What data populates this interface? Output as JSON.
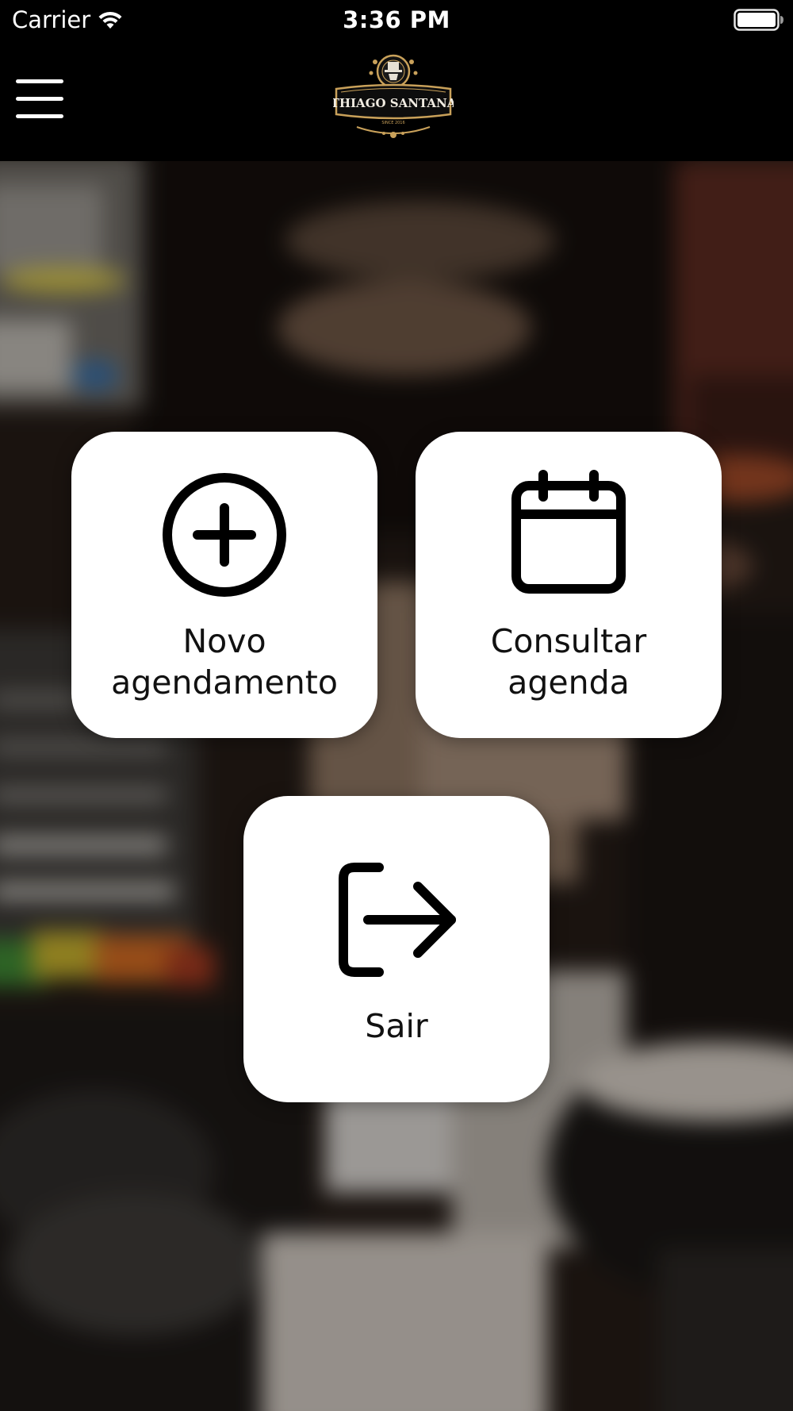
{
  "status_bar": {
    "carrier": "Carrier",
    "time": "3:36 PM",
    "wifi_icon": "wifi-icon",
    "battery_icon": "battery-full-icon"
  },
  "nav_bar": {
    "menu_icon": "hamburger-menu-icon",
    "logo": {
      "name": "THIAGO SANTANA",
      "tagline": "SINCE 2016"
    }
  },
  "tiles": [
    {
      "id": "new",
      "label": "Novo\nagendamento",
      "icon": "plus-circle-icon"
    },
    {
      "id": "consult",
      "label": "Consultar\nagenda",
      "icon": "calendar-icon"
    },
    {
      "id": "exit",
      "label": "Sair",
      "icon": "logout-icon"
    }
  ],
  "colors": {
    "bar_background": "#000000",
    "tile_background": "#ffffff",
    "text_primary": "#111111",
    "logo_gold": "#c9a15a"
  }
}
